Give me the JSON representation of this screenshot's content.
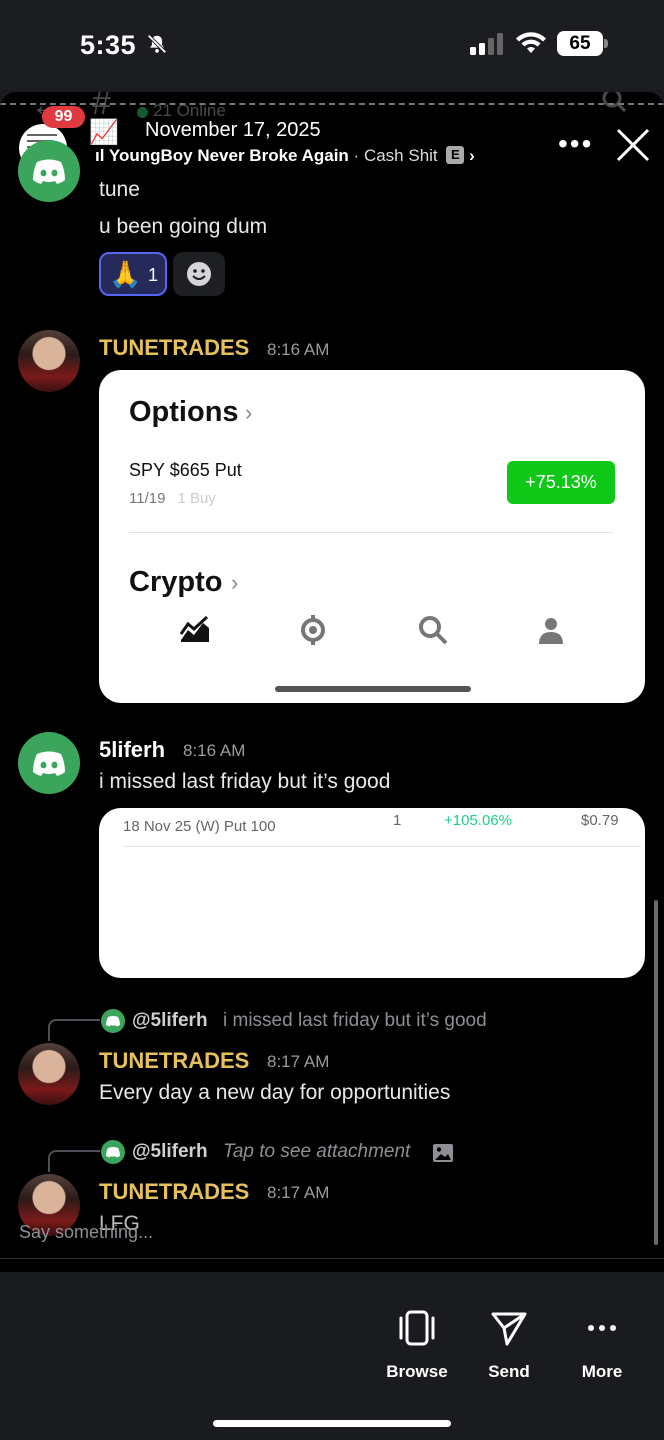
{
  "status_bar": {
    "time": "5:35",
    "battery": "65"
  },
  "story": {
    "unread_count": "99",
    "chart_emoji": "📈",
    "date": "November 17, 2025",
    "artist": "YoungBoy Never Broke Again",
    "separator": "·",
    "song": "Cash Shit",
    "explicit": "E",
    "chevron": "›",
    "more": "•••",
    "online": "21 Online",
    "input_placeholder": "Say something..."
  },
  "messages": {
    "m1": {
      "line1": "tune",
      "line2": "u been going dum",
      "reaction_emoji": "🙏",
      "reaction_count": "1"
    },
    "m2": {
      "author": "TUNETRADES",
      "time": "8:16 AM"
    },
    "card1": {
      "options_label": "Options",
      "position": "SPY $665 Put",
      "expiry": "11/19",
      "expiry_ghost": "1 Buy",
      "gain": "+75.13%",
      "crypto_label": "Crypto"
    },
    "m3": {
      "author": "5liferh",
      "time": "8:16 AM",
      "text": "i missed last friday but it’s good"
    },
    "card2": {
      "contract": "18 Nov 25 (W) Put 100",
      "qty": "1",
      "pct": "+105.06%",
      "price": "$0.79"
    },
    "m4": {
      "reply_author": "@5liferh",
      "reply_text": "i missed last friday but it’s good",
      "author": "TUNETRADES",
      "time": "8:17 AM",
      "text": "Every day a new day for opportunities"
    },
    "m5": {
      "reply_author": "@5liferh",
      "reply_text": "Tap to see attachment",
      "author": "TUNETRADES",
      "time": "8:17 AM",
      "text": "LFG"
    }
  },
  "bottom_bar": {
    "browse": "Browse",
    "send": "Send",
    "more": "More"
  },
  "colors": {
    "discord_green": "#3ba55c",
    "gold_name": "#e6c15a",
    "gain_green": "#10c818",
    "badge_red": "#e0393e"
  }
}
